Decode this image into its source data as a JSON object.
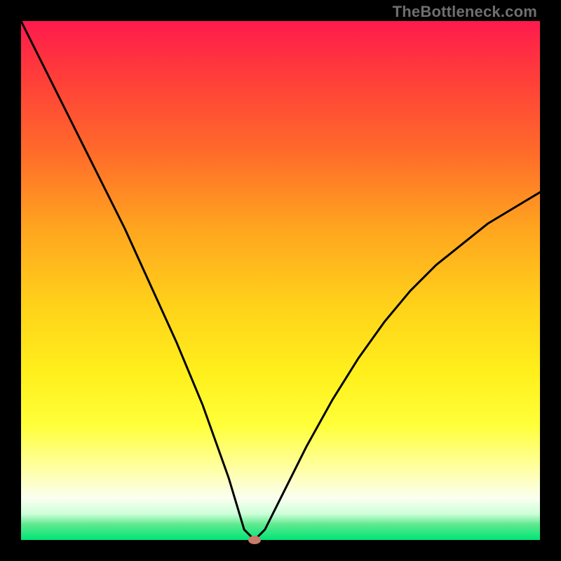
{
  "watermark": "TheBottleneck.com",
  "chart_data": {
    "type": "line",
    "title": "",
    "xlabel": "",
    "ylabel": "",
    "xlim": [
      0,
      100
    ],
    "ylim": [
      0,
      100
    ],
    "series": [
      {
        "name": "bottleneck-curve",
        "x": [
          0,
          5,
          10,
          15,
          20,
          25,
          30,
          35,
          40,
          43,
          45,
          47,
          50,
          55,
          60,
          65,
          70,
          75,
          80,
          85,
          90,
          95,
          100
        ],
        "values": [
          100,
          90,
          80,
          70,
          60,
          49,
          38,
          26,
          12,
          2,
          0,
          2,
          8,
          18,
          27,
          35,
          42,
          48,
          53,
          57,
          61,
          64,
          67
        ]
      }
    ],
    "annotations": [
      {
        "type": "marker",
        "name": "optimum-point",
        "x": 45,
        "y": 0
      }
    ],
    "gradient_stops": [
      {
        "pos": 0,
        "color": "#ff1a4d"
      },
      {
        "pos": 25,
        "color": "#ff6a2a"
      },
      {
        "pos": 55,
        "color": "#ffd21a"
      },
      {
        "pos": 78,
        "color": "#ffff3a"
      },
      {
        "pos": 100,
        "color": "#00e676"
      }
    ]
  }
}
